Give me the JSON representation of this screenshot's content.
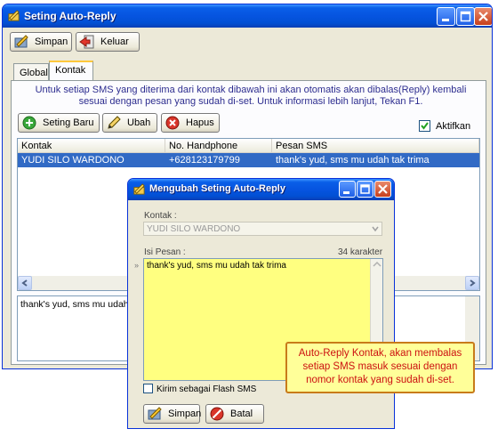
{
  "main_window": {
    "title": "Seting Auto-Reply",
    "toolbar": {
      "save_label": "Simpan",
      "exit_label": "Keluar"
    },
    "tabs": [
      "Global",
      "Kontak"
    ],
    "info_text": "Untuk setiap SMS yang diterima dari kontak dibawah ini akan otomatis akan dibalas(Reply) kembali sesuai dengan pesan yang sudah di-set. Untuk informasi lebih lanjut, Tekan F1.",
    "actions": {
      "new_label": "Seting Baru",
      "edit_label": "Ubah",
      "delete_label": "Hapus"
    },
    "active_label": "Aktifkan",
    "active_checked": true,
    "table": {
      "columns": [
        "Kontak",
        "No. Handphone",
        "Pesan SMS"
      ],
      "rows": [
        {
          "kontak": "YUDI SILO WARDONO",
          "phone": "+628123179799",
          "pesan": "thank's yud, sms mu udah tak trima"
        }
      ]
    },
    "preview_text": "thank's yud, sms mu udah"
  },
  "dialog": {
    "title": "Mengubah Seting Auto-Reply",
    "kontak_label": "Kontak :",
    "kontak_value": "YUDI SILO WARDONO",
    "isi_label": "Isi Pesan :",
    "char_count": "34 karakter",
    "message": "thank's yud, sms mu udah tak trima",
    "flash_label": "Kirim sebagai Flash SMS",
    "flash_checked": false,
    "save_label": "Simpan",
    "cancel_label": "Batal"
  },
  "callout": {
    "text": "Auto-Reply Kontak, akan membalas setiap SMS masuk sesuai dengan nomor kontak yang sudah di-set."
  },
  "colors": {
    "titlebar": "#0054e3",
    "selection": "#316ac5",
    "memo_background": "#ffff80",
    "callout_text": "#cc1111",
    "callout_border": "#c87b1a"
  }
}
